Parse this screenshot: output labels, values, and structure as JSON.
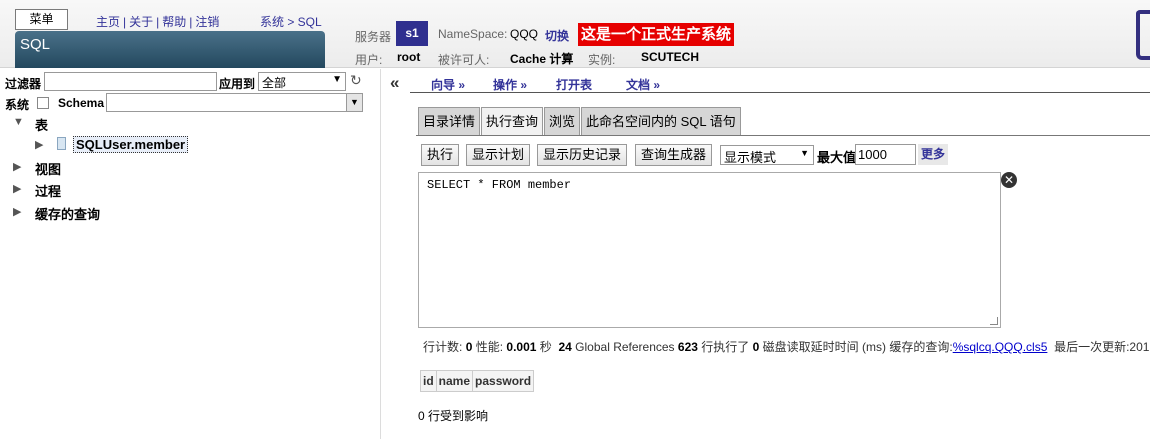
{
  "header": {
    "menu_button": "菜单",
    "links": [
      "主页",
      "关于",
      "帮助",
      "注销"
    ],
    "breadcrumb": "系统 > SQL",
    "page_banner": "SQL",
    "server_label": "服务器",
    "server_value": "s1",
    "namespace_label": "NameSpace:",
    "namespace_value": "QQQ",
    "switch_label": "切换",
    "production_banner": "这是一个正式生产系统",
    "user_label": "用户:",
    "user_value": "root",
    "licensee_label": "被许可人:",
    "licensee_value": "Cache 计算",
    "instance_label": "实例:",
    "instance_value": "SCUTECH"
  },
  "left_panel": {
    "filter_label": "过滤器",
    "filter_value": "",
    "apply_to_label": "应用到",
    "apply_to_value": "全部",
    "system_label": "系统",
    "schema_label": "Schema",
    "schema_value": "",
    "tree": {
      "tables_label": "表",
      "table_item": "SQLUser.member",
      "views_label": "视图",
      "procedures_label": "过程",
      "cached_queries_label": "缓存的查询"
    }
  },
  "nav": {
    "items": [
      "向导 »",
      "操作 »",
      "打开表",
      "文档 »"
    ]
  },
  "tabs": [
    "目录详情",
    "执行查询",
    "浏览",
    "此命名空间内的 SQL 语句"
  ],
  "active_tab": "执行查询",
  "toolbar": {
    "execute": "执行",
    "show_plan": "显示计划",
    "show_history": "显示历史记录",
    "query_builder": "查询生成器",
    "display_mode": "显示模式",
    "max_label": "最大值",
    "max_value": "1000",
    "more": "更多"
  },
  "query_text": "SELECT * FROM member",
  "stats": {
    "row_count_label": "行计数:",
    "row_count": "0",
    "performance_label": "性能:",
    "performance": "0.001",
    "seconds_label": "秒",
    "global_refs": "24",
    "global_refs_label": "Global References",
    "lines_executed": "623",
    "lines_executed_label": "行执行了",
    "disk_latency": "0",
    "disk_latency_label": "磁盘读取延时时间 (ms)",
    "cached_query_label": "缓存的查询:",
    "cached_query_link": "%sqlcq.QQQ.cls5",
    "last_update_label": "最后一次更新:201"
  },
  "result_columns": [
    "id",
    "name",
    "password"
  ],
  "rows_affected": "0 行受到影响",
  "colors": {
    "link": "#333399",
    "banner_bg": "#2e5870",
    "production_bg": "#e60000",
    "server_box": "#2f2f8f"
  }
}
